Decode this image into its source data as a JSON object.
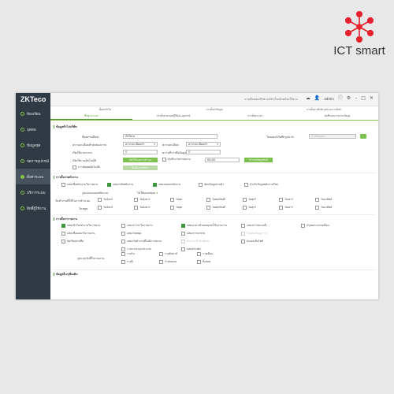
{
  "brand": {
    "name": "ICT smart",
    "accent": "#e8212e"
  },
  "window": {
    "logo": "ZKTeco",
    "status_message": "การเชื่อมต่อเซิร์ฟเวอร์สำเร็จแล้วพร้อมใช้งาน",
    "user": "admin",
    "controls": [
      "cloud-icon",
      "user-icon",
      "info-icon",
      "gear-icon",
      "minimize-icon",
      "maximize-icon",
      "close-icon"
    ]
  },
  "sidebar": {
    "items": [
      {
        "label": "ห้องเรียน",
        "icon": "classroom-icon"
      },
      {
        "label": "บุคคล",
        "icon": "person-icon"
      },
      {
        "label": "ข้อมูลชุด",
        "icon": "data-icon"
      },
      {
        "label": "จัดการอุปกรณ์",
        "icon": "device-icon"
      },
      {
        "label": "ตั้งค่าระบบ",
        "icon": "settings-icon"
      },
      {
        "label": "บริการระบบ",
        "icon": "service-icon"
      },
      {
        "label": "สิทธิ์ผู้ใช้งาน",
        "icon": "permission-icon"
      }
    ],
    "active_index": 4,
    "bg_color": "#2f3a45",
    "accent": "#8bc34a"
  },
  "tabs_row1": [
    "ตั้งค่าทั่วไป",
    "การตั้งค่าข้อมูล",
    "การตั้งค่าเซิร์ฟเวอร์และการซิงค์"
  ],
  "tabs_row2": [
    {
      "label": "พื้นฐานระบบ",
      "active": true
    },
    {
      "label": "การตั้งค่าแผนกผู้ใช้และอุปกรณ์",
      "active": false
    },
    {
      "label": "การตั้งค่าเวลา",
      "active": false
    },
    {
      "label": "บันทึกและรายงานข้อมูล",
      "active": false
    }
  ],
  "section1": {
    "title": "ข้อมูลทั่วไปบริษัท",
    "company_name_label": "ชื่อสถานศึกษา",
    "company_name_value": "ZKTeco",
    "logo_path_label": "โฟลเดอร์บันทึกรูปภาพ",
    "logo_path_placeholder": "C:\\images",
    "format_label": "ความละเอียดต่ำสุดของภาพ",
    "format_value": "ความละเอียดต่ำ",
    "resolution_label": "ความละเอียด",
    "resolution_value": "ความละเอียดต่ำ",
    "start_label": "เปิดใช้งานระบบ",
    "start_value": "0",
    "delay_label": "ความถี่การดึงข้อมูล",
    "delay_value": "0",
    "auto_label": "เปิดใช้งานอัตโนมัติ",
    "auto_button": "เปิดใช้งานการสำรอง",
    "sync_check": "บันทึกภาพการสแกน",
    "time_value": "00:00",
    "backup_button": "สำรองข้อมูลทันที",
    "extra_check": "การอัพเดตอัตโนมัติ",
    "extra_button": "ยืนยันการตั้งค่า"
  },
  "section2": {
    "title": "การตั้งค่าพนักงาน",
    "checks": [
      {
        "label": "แสดงชื่อพนักงานในรายงาน",
        "on": false
      },
      {
        "label": "แสดงรหัสพนักงาน",
        "on": true
      },
      {
        "label": "แสดงแผนกพนักงาน",
        "on": true
      },
      {
        "label": "ซ่อนข้อมูลส่วนตัว",
        "on": false
      },
      {
        "label": "นำเข้าข้อมูลพนักงานใหม่",
        "on": false
      }
    ],
    "dept_label": "รูปแบบแผนกพนักงาน",
    "dept_value": "ไม่ใช้แผนกย่อย",
    "weekday_label": "วันทำงานที่ใช้ในการคำนวณ",
    "weekdays": [
      "วันจันทร์",
      "วันอังคาร",
      "วันพุธ",
      "วันพฤหัสบดี",
      "วันศุกร์",
      "วันเสาร์",
      "วันอาทิตย์"
    ],
    "holiday_label": "วันหยุด",
    "holidays": [
      "วันจันทร์",
      "วันอังคาร",
      "วันพุธ",
      "วันพฤหัสบดี",
      "วันศุกร์",
      "วันเสาร์",
      "วันอาทิตย์"
    ]
  },
  "section3": {
    "title": "การตั้งค่ารายงาน",
    "checks_row1": [
      {
        "label": "แสดงชั่วโมงทำงานในรายงาน",
        "on": true
      },
      {
        "label": "แสดงการลาในรายงาน",
        "on": false
      },
      {
        "label": "แสดงเวลาเข้าออกทุกครั้งในรายงาน",
        "on": true
      },
      {
        "label": "แสดงการสแกนซ้ำ",
        "on": false
      },
      {
        "label": "สรุปผลรวมรายเดือน",
        "on": false
      }
    ],
    "checks_row2": [
      {
        "label": "แสดงชื่อแผนกในรายงาน",
        "on": false
      },
      {
        "label": "แสดงวันหยุด",
        "on": false
      },
      {
        "label": "แสดงการมาสาย",
        "on": false
      },
      {
        "label": "ไม่แสดงข้อมูลว่าง",
        "on": false,
        "dim": true
      }
    ],
    "checks_row3": [
      {
        "label": "จัดเรียงตามชื่อ",
        "on": false
      },
      {
        "label": "แสดงวันทำงานที่ไม่มีการสแกน",
        "on": false
      },
      {
        "label": "คำนวณชั่วโมงพิเศษ",
        "on": false,
        "dim": true
      },
      {
        "label": "ส่งออกเป็นไฟล์",
        "on": false
      }
    ],
    "checks_row4": [
      {
        "label": "รวมการลาทุกประเภท",
        "on": false
      },
      {
        "label": "แสดงช่วงพัก",
        "on": false
      }
    ],
    "format_label": "รูปแบบวันที่ในรายงาน",
    "format_options": [
      {
        "label": "รายวัน"
      },
      {
        "label": "รายสัปดาห์"
      },
      {
        "label": "รายเดือน"
      },
      {
        "label": "รายปี"
      },
      {
        "label": "กำหนดเอง"
      },
      {
        "label": "ทั้งหมด"
      }
    ]
  },
  "section4": {
    "title": "ข้อมูลอื่นๆเพิ่มเติม"
  }
}
